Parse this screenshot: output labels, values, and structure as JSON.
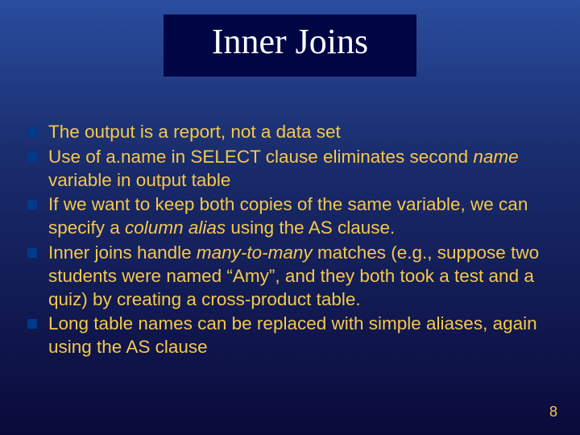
{
  "title": "Inner Joins",
  "bullets": [
    {
      "html": "The output is a report, not a data set"
    },
    {
      "html": "Use of a.name in SELECT clause eliminates second <em>name</em> variable in output table"
    },
    {
      "html": "If we want to keep both copies of the same variable, we can specify a <em>column alias</em> using the AS clause."
    },
    {
      "html": "Inner joins handle <em>many-to-many</em> matches (e.g., suppose two students were named “Amy”, and they both took a test and a quiz) by creating a cross-product table."
    },
    {
      "html": "Long table names can be replaced with simple aliases, again using the AS clause"
    }
  ],
  "page_number": "8"
}
